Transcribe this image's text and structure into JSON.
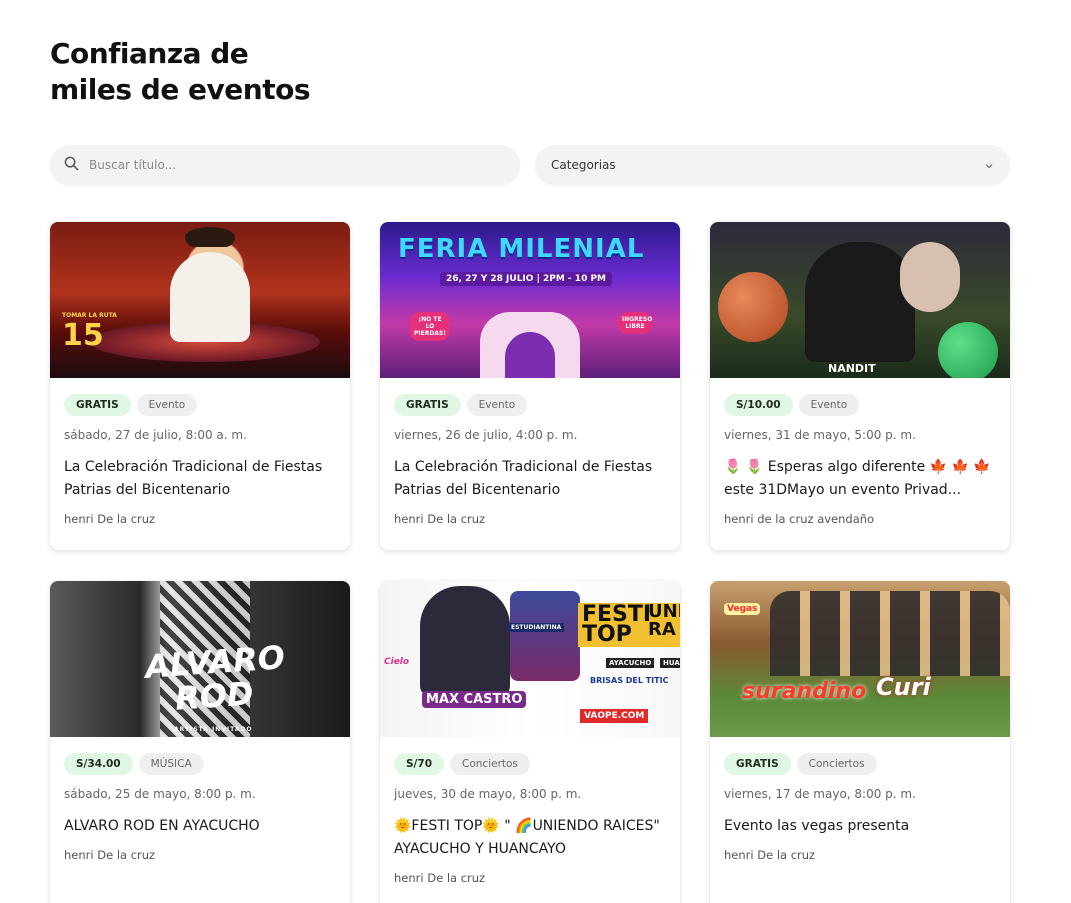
{
  "header": {
    "line1": "Confianza de",
    "line2": "miles de eventos"
  },
  "search": {
    "placeholder": "Buscar título..."
  },
  "filter": {
    "label": "Categorias"
  },
  "cards": [
    {
      "image_text": [
        "TOMAR LA RUTA",
        "15"
      ],
      "price": "GRATIS",
      "category": "Evento",
      "date": "sábado, 27 de julio, 8:00 a. m.",
      "title": "La Celebración Tradicional de Fiestas Patrias del Bicentenario",
      "author": "henri De la cruz"
    },
    {
      "image_text": [
        "FERIA MILENIAL",
        "26, 27 Y 28 JULIO | 2PM - 10 PM",
        "¡NO TE LO PIERDAS!",
        "INGRESO LIBRE"
      ],
      "price": "GRATIS",
      "category": "Evento",
      "date": "viernes, 26 de julio, 4:00 p. m.",
      "title": "La Celebración Tradicional de Fiestas Patrias del Bicentenario",
      "author": "henri De la cruz"
    },
    {
      "image_text": [
        "NANDIT"
      ],
      "price": "S/10.00",
      "category": "Evento",
      "date": "viernes, 31 de mayo, 5:00 p. m.",
      "title": "🌷 🌷 Esperas algo diferente 🍁 🍁 🍁 este 31DMayo un evento Privad...",
      "author": "henri de la cruz avendaño"
    },
    {
      "image_text": [
        "ALVARO",
        "ROD",
        "ARTISTA INVITADO"
      ],
      "price": "S/34.00",
      "category": "MÚSICA",
      "date": "sábado, 25 de mayo, 8:00 p. m.",
      "title": "ALVARO ROD EN AYACUCHO",
      "author": "henri De la cruz"
    },
    {
      "image_text": [
        "FESTI TOP",
        "UNI RA",
        "AYACUCHO",
        "HUA",
        "BRISAS DEL TITIC",
        "VAOPE.COM",
        "MAX CASTRO",
        "ESTUDIANTINA",
        "Cielo"
      ],
      "price": "S/70",
      "category": "Conciertos",
      "date": "jueves, 30 de mayo, 8:00 p. m.",
      "title": "🌞FESTI TOP🌞 \" 🌈UNIENDO RAICES\" AYACUCHO Y HUANCAYO",
      "author": "henri De la cruz"
    },
    {
      "image_text": [
        "surandino",
        "Curi",
        "Vegas"
      ],
      "price": "GRATIS",
      "category": "Conciertos",
      "date": "viernes, 17 de mayo, 8:00 p. m.",
      "title": "Evento las vegas presenta",
      "author": "henri De la cruz"
    }
  ],
  "colors": {
    "price_badge_bg": "#dff7e4",
    "category_badge_bg": "#efefef",
    "input_bg": "#f3f3f3"
  },
  "icons": {
    "search": "search-icon",
    "dropdown": "chevron-down-icon"
  }
}
